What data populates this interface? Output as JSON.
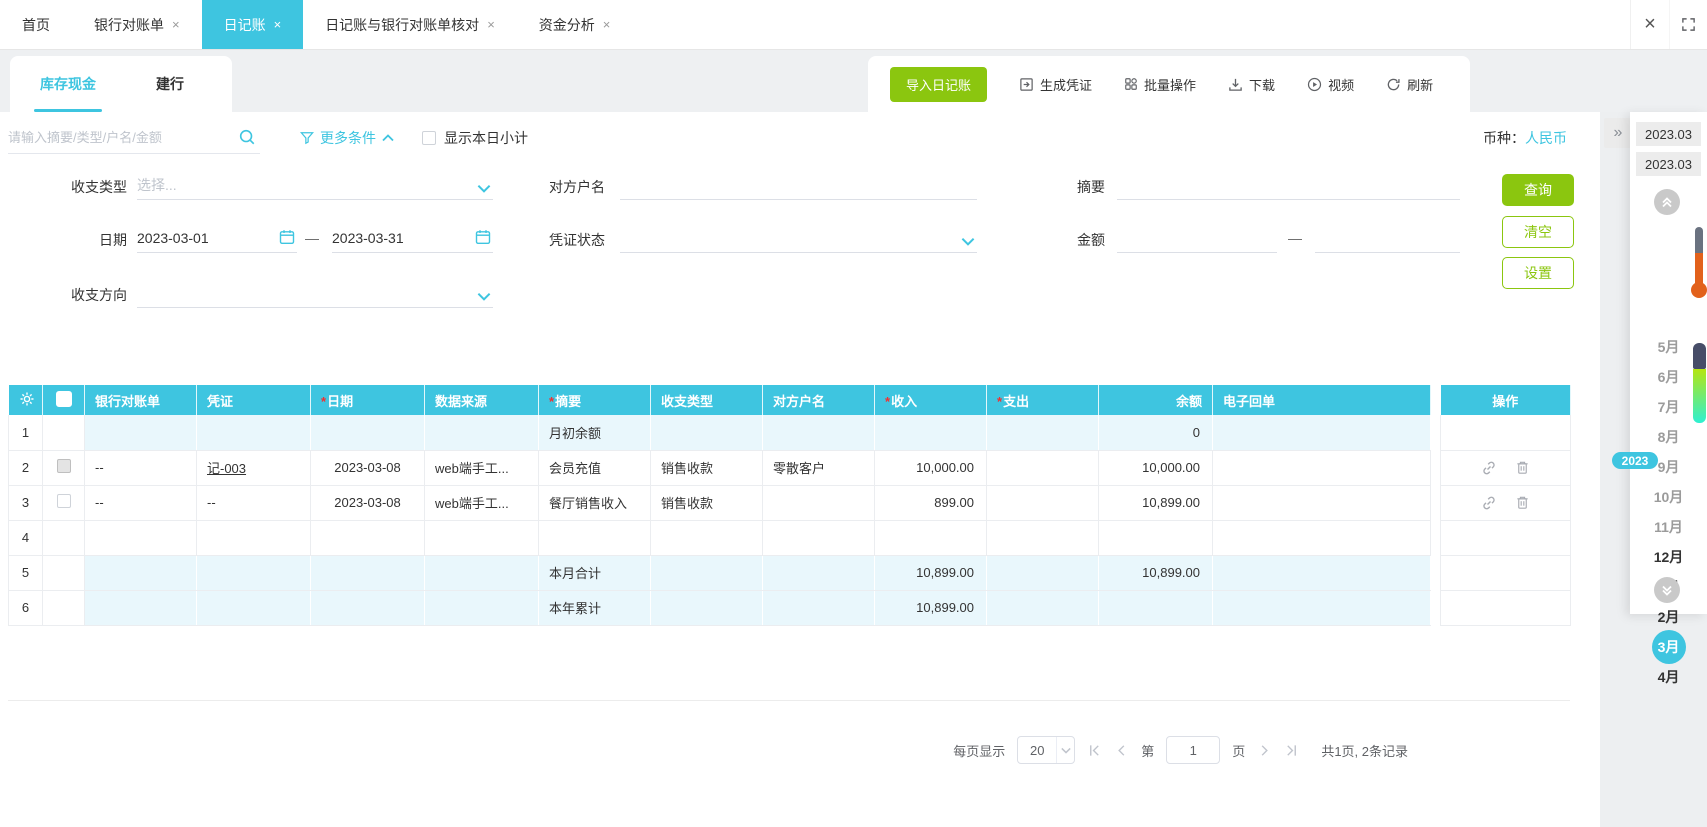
{
  "topbar": {
    "tabs": [
      {
        "label": "首页",
        "closable": false,
        "active": false
      },
      {
        "label": "银行对账单",
        "closable": true,
        "active": false
      },
      {
        "label": "日记账",
        "closable": true,
        "active": true
      },
      {
        "label": "日记账与银行对账单核对",
        "closable": true,
        "active": false
      },
      {
        "label": "资金分析",
        "closable": true,
        "active": false
      }
    ],
    "tab_close": "×",
    "close": "×"
  },
  "subtabs": [
    {
      "label": "库存现金",
      "active": true
    },
    {
      "label": "建行",
      "active": false
    }
  ],
  "toolbar": {
    "import": "导入日记账",
    "voucher": "生成凭证",
    "batch": "批量操作",
    "download": "下载",
    "video": "视频",
    "refresh": "刷新"
  },
  "search": {
    "placeholder": "请输入摘要/类型/户名/金额",
    "more": "更多条件",
    "subtotal": "显示本日小计",
    "currency_label": "币种：",
    "currency": "人民币"
  },
  "filters": {
    "type_label": "收支类型",
    "type_placeholder": "选择...",
    "party_label": "对方户名",
    "summary_label": "摘要",
    "date_label": "日期",
    "date_from": "2023-03-01",
    "date_sep": "—",
    "date_to": "2023-03-31",
    "voucher_status_label": "凭证状态",
    "amount_label": "金额",
    "amount_sep": "—",
    "direction_label": "收支方向",
    "query": "查询",
    "clear": "清空",
    "settings": "设置"
  },
  "table": {
    "req_mark": "*",
    "headers": [
      "银行对账单",
      "凭证",
      "日期",
      "数据来源",
      "摘要",
      "收支类型",
      "对方户名",
      "收入",
      "支出",
      "余额",
      "电子回单"
    ],
    "ops_header": "操作",
    "rows": [
      {
        "num": "1",
        "kind": "summary",
        "bank": "",
        "voucher": "",
        "date": "",
        "source": "",
        "summary": "月初余额",
        "type": "",
        "party": "",
        "income": "",
        "expense": "",
        "balance": "0",
        "receipt": ""
      },
      {
        "num": "2",
        "kind": "data",
        "bank": "--",
        "voucher": "记-003",
        "date": "2023-03-08",
        "source": "web端手工...",
        "summary": "会员充值",
        "type": "销售收款",
        "party": "零散客户",
        "income": "10,000.00",
        "expense": "",
        "balance": "10,000.00",
        "receipt": ""
      },
      {
        "num": "3",
        "kind": "data",
        "bank": "--",
        "voucher": "--",
        "date": "2023-03-08",
        "source": "web端手工...",
        "summary": "餐厅销售收入",
        "type": "销售收款",
        "party": "",
        "income": "899.00",
        "expense": "",
        "balance": "10,899.00",
        "receipt": ""
      },
      {
        "num": "4",
        "kind": "empty",
        "bank": "",
        "voucher": "",
        "date": "",
        "source": "",
        "summary": "",
        "type": "",
        "party": "",
        "income": "",
        "expense": "",
        "balance": "",
        "receipt": ""
      },
      {
        "num": "5",
        "kind": "summary",
        "bank": "",
        "voucher": "",
        "date": "",
        "source": "",
        "summary": "本月合计",
        "type": "",
        "party": "",
        "income": "10,899.00",
        "expense": "",
        "balance": "10,899.00",
        "receipt": ""
      },
      {
        "num": "6",
        "kind": "summary",
        "bank": "",
        "voucher": "",
        "date": "",
        "source": "",
        "summary": "本年累计",
        "type": "",
        "party": "",
        "income": "10,899.00",
        "expense": "",
        "balance": "",
        "receipt": ""
      }
    ]
  },
  "pagination": {
    "per_page_label": "每页显示",
    "per_page": "20",
    "goto_prefix": "第",
    "page": "1",
    "goto_suffix": "页",
    "summary": "共1页, 2条记录"
  },
  "sidebar": {
    "collapse": "»",
    "period_boxes": [
      "2023.03",
      "2023.03"
    ],
    "year_badge": "2023",
    "months": [
      {
        "label": "5月",
        "tone": "muted"
      },
      {
        "label": "6月",
        "tone": "muted"
      },
      {
        "label": "7月",
        "tone": "muted"
      },
      {
        "label": "8月",
        "tone": "muted"
      },
      {
        "label": "9月",
        "tone": "muted"
      },
      {
        "label": "10月",
        "tone": "muted"
      },
      {
        "label": "11月",
        "tone": "muted"
      },
      {
        "label": "12月",
        "tone": "dark"
      },
      {
        "label": "1月",
        "tone": "dark"
      },
      {
        "label": "2月",
        "tone": "dark"
      },
      {
        "label": "3月",
        "tone": "selected"
      },
      {
        "label": "4月",
        "tone": "dark"
      }
    ]
  },
  "colors": {
    "accent": "#3ec5e0",
    "green": "#8bc60f",
    "row_highlight": "#e9f7fc",
    "required_mark": "#f23030"
  }
}
